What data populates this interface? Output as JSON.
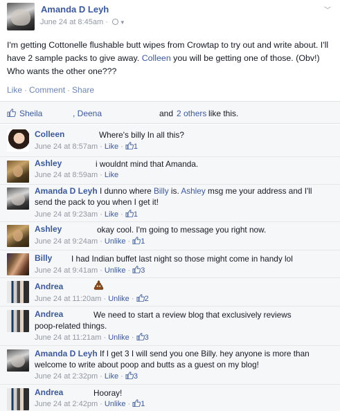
{
  "post": {
    "author": "Amanda D Leyh",
    "timestamp": "June 24 at 8:45am ·",
    "privacy_icon": "globe-icon",
    "body_before_mention": "I'm getting Cottonelle flushable butt wipes from Crowtap to try out and write about. I'll have 2 sample packs to give away. ",
    "mention": "Colleen",
    "body_after_mention": " you will be getting one of those. (Obv!) Who wants the other one???",
    "actions": [
      "Like",
      "Comment",
      "Share"
    ]
  },
  "likes_bar": {
    "names": [
      "Sheila",
      ", Deena"
    ],
    "and_text": "and",
    "others_link": "2 others",
    "suffix": "like this."
  },
  "comments": [
    {
      "name": "Colleen",
      "text": "Where's billy In all this?",
      "time": "June 24 at 8:57am",
      "action": "Like",
      "likes": "1"
    },
    {
      "name": "Ashley",
      "text": "i wouldnt mind that Amanda.",
      "time": "June 24 at 8:59am",
      "action": "Like",
      "likes": ""
    },
    {
      "name": "Amanda D Leyh",
      "text_parts": [
        "I dunno where ",
        "Billy",
        " is. ",
        "Ashley",
        " msg me your address and I'll"
      ],
      "text_line2": "send the pack to you when I get it!",
      "time": "June 24 at 9:23am",
      "action": "Like",
      "likes": "1"
    },
    {
      "name": "Ashley",
      "text": "okay cool. I'm going to message you right now.",
      "time": "June 24 at 9:24am",
      "action": "Unlike",
      "likes": "1"
    },
    {
      "name": "Billy",
      "text": "I had Indian buffet last night so those might come in handy lol",
      "time": "June 24 at 9:41am",
      "action": "Unlike",
      "likes": "3"
    },
    {
      "name": "Andrea",
      "text": "",
      "emoji": "poop-emoji",
      "time": "June 24 at 11:20am",
      "action": "Unlike",
      "likes": "2"
    },
    {
      "name": "Andrea",
      "text": "We need to start a review blog that exclusively reviews",
      "text_line2": "poop-related things.",
      "time": "June 24 at 11:21am",
      "action": "Unlike",
      "likes": "3"
    },
    {
      "name": "Amanda D Leyh",
      "text": "If I get 3 I will send you one Billy. hey anyone is more than",
      "text_line2": "welcome to write about poop and butts as a guest on my blog!",
      "time": "June 24 at 2:32pm",
      "action": "Like",
      "likes": "3"
    },
    {
      "name": "Andrea",
      "text": "Hooray!",
      "time": "June 24 at 2:42pm",
      "action": "Unlike",
      "likes": "1"
    }
  ],
  "colors": {
    "link": "#3b5998",
    "meta": "#9197a3",
    "comment_bg": "#f6f7f8"
  }
}
